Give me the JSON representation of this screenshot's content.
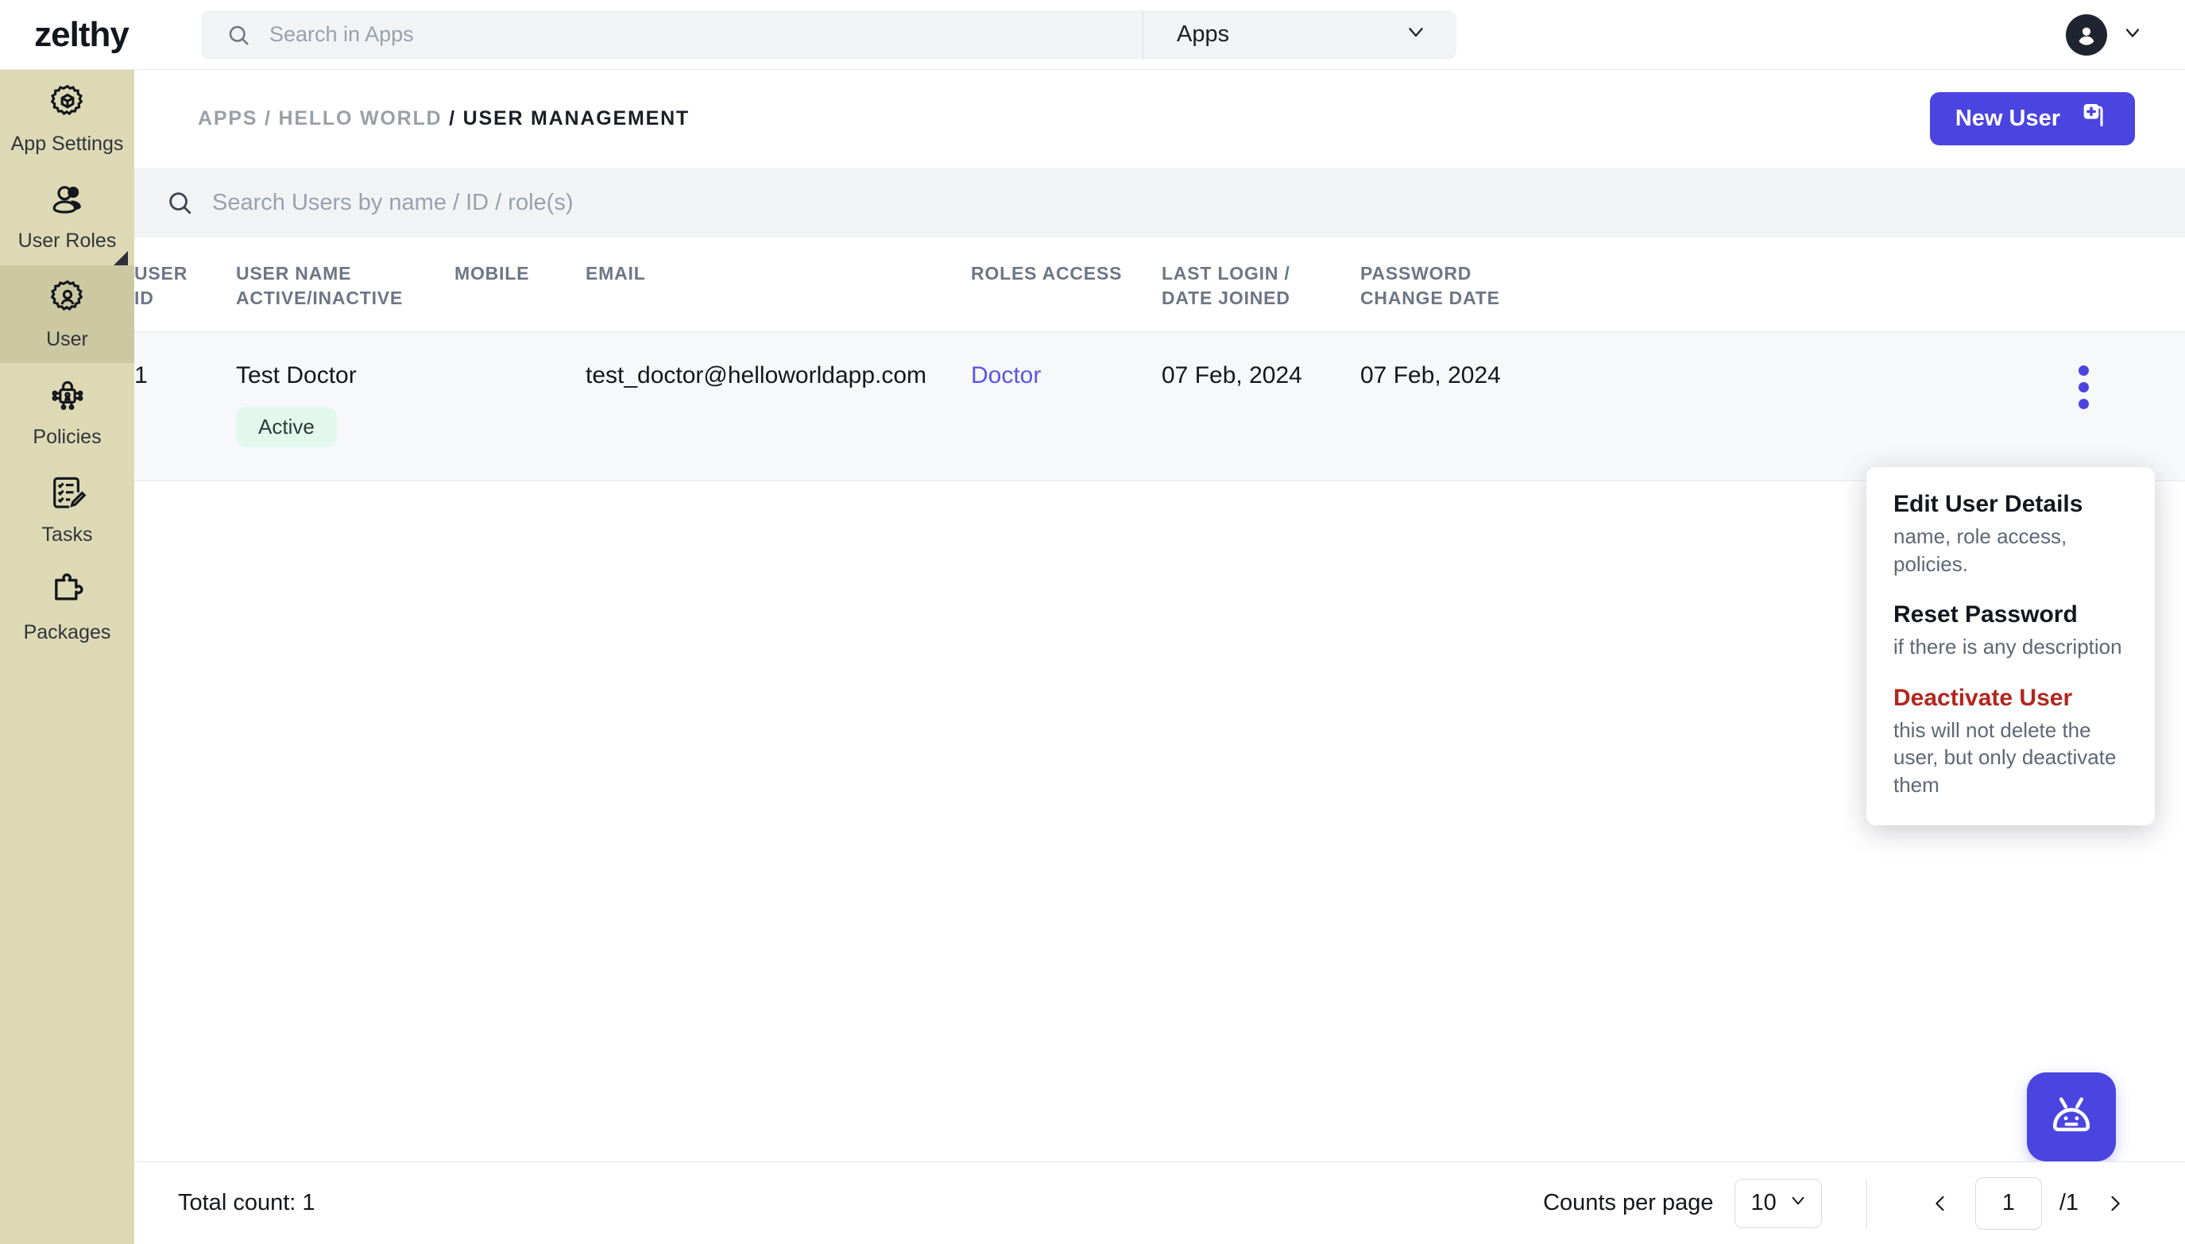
{
  "brand": {
    "logo": "zelthy"
  },
  "topbar": {
    "search_placeholder": "Search in Apps",
    "search_value": "",
    "scope_label": "Apps"
  },
  "sidebar": {
    "items": [
      {
        "label": "App Settings",
        "icon": "gear-cube-icon",
        "active": false
      },
      {
        "label": "User Roles",
        "icon": "users-icon",
        "active": false
      },
      {
        "label": "User",
        "icon": "gear-user-icon",
        "active": true
      },
      {
        "label": "Policies",
        "icon": "lock-network-icon",
        "active": false
      },
      {
        "label": "Tasks",
        "icon": "checklist-pencil-icon",
        "active": false
      },
      {
        "label": "Packages",
        "icon": "puzzle-piece-icon",
        "active": false
      }
    ]
  },
  "breadcrumb": {
    "parts": [
      "APPS",
      "HELLO WORLD"
    ],
    "separator": "/",
    "current": "USER MANAGEMENT",
    "full": "APPS / HELLO WORLD"
  },
  "actions": {
    "new_user": "New User"
  },
  "user_search": {
    "placeholder": "Search Users by name / ID / role(s)",
    "value": ""
  },
  "table": {
    "columns": [
      {
        "line1": "USER",
        "line2": "ID"
      },
      {
        "line1": "USER NAME",
        "line2": "ACTIVE/INACTIVE"
      },
      {
        "line1": "MOBILE",
        "line2": ""
      },
      {
        "line1": "EMAIL",
        "line2": ""
      },
      {
        "line1": "ROLES ACCESS",
        "line2": ""
      },
      {
        "line1": "LAST LOGIN /",
        "line2": "DATE JOINED"
      },
      {
        "line1": "PASSWORD",
        "line2": "CHANGE DATE"
      },
      {
        "line1": "",
        "line2": ""
      }
    ],
    "rows": [
      {
        "user_id": "1",
        "user_name": "Test Doctor",
        "status": "Active",
        "mobile": "",
        "email": "test_doctor@helloworldapp.com",
        "roles_access": "Doctor",
        "last_login": "07 Feb, 2024",
        "password_change_date": "07 Feb, 2024"
      }
    ]
  },
  "row_menu": {
    "items": [
      {
        "title": "Edit User Details",
        "desc": "name, role access, policies.",
        "danger": false
      },
      {
        "title": "Reset Password",
        "desc": "if there is any description",
        "danger": false
      },
      {
        "title": "Deactivate User",
        "desc": "this will not delete the user, but only deactivate them",
        "danger": true
      }
    ]
  },
  "footer": {
    "total_count": "Total count: 1",
    "counts_per_page_label": "Counts per page",
    "counts_per_page_value": "10",
    "page_value": "1",
    "page_total": "/1"
  },
  "fab": {
    "icon": "robot-icon"
  },
  "colors": {
    "accent": "#4a44e0",
    "sidebar": "#ddd9b4",
    "sidebar_active": "#ccc8a2",
    "danger": "#b3261e",
    "badge_bg": "#e2f8ed",
    "row_bg": "#f7f8fa"
  }
}
